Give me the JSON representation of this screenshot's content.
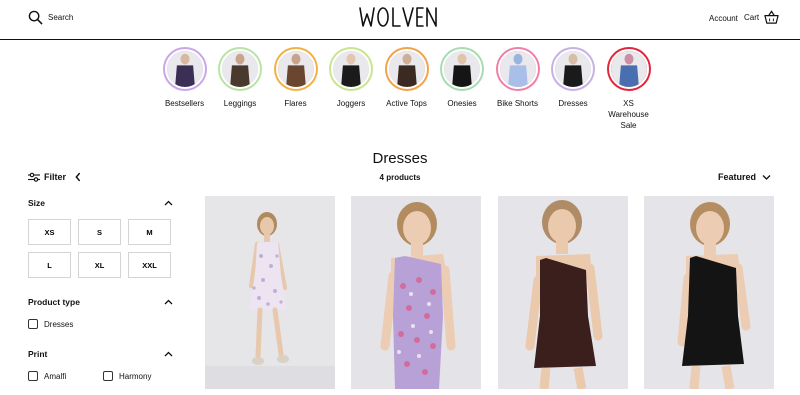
{
  "header": {
    "search_label": "Search",
    "logo_text": "WOLVEN",
    "account_label": "Account",
    "cart_label": "Cart"
  },
  "categories": [
    {
      "label": "Bestsellers",
      "ring": "#c9a6e8"
    },
    {
      "label": "Leggings",
      "ring": "#b9e3a4"
    },
    {
      "label": "Flares",
      "ring": "#f3b046"
    },
    {
      "label": "Joggers",
      "ring": "#c8e58e"
    },
    {
      "label": "Active Tops",
      "ring": "#f2a34a"
    },
    {
      "label": "Onesies",
      "ring": "#a7dbb0"
    },
    {
      "label": "Bike Shorts",
      "ring": "#f07fa8"
    },
    {
      "label": "Dresses",
      "ring": "#c7b0e6"
    },
    {
      "label": "XS Warehouse Sale",
      "ring": "#e0263a"
    }
  ],
  "page": {
    "title": "Dresses",
    "product_count": "4 products",
    "filter_label": "Filter",
    "sort_label": "Featured"
  },
  "filters": {
    "size": {
      "title": "Size",
      "options": [
        "XS",
        "S",
        "M",
        "L",
        "XL",
        "XXL"
      ]
    },
    "product_type": {
      "title": "Product type",
      "options": [
        "Dresses"
      ]
    },
    "print": {
      "title": "Print",
      "options": [
        "Amalfi",
        "Harmony"
      ]
    }
  },
  "products": [
    {
      "dress": "floral-light",
      "color": "#ece4f0"
    },
    {
      "dress": "floral-pink",
      "color": "#b7a1d6"
    },
    {
      "dress": "brown",
      "color": "#3a1f1c"
    },
    {
      "dress": "black",
      "color": "#141414"
    }
  ]
}
